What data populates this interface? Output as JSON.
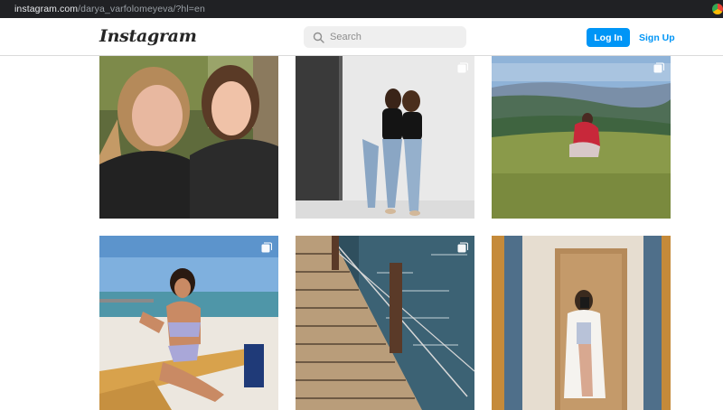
{
  "browser": {
    "url_host": "instagram.com",
    "url_path": "/darya_varfolomeyeva/?hl=en"
  },
  "header": {
    "logo": "Instagram",
    "search_placeholder": "Search",
    "login_label": "Log In",
    "signup_label": "Sign Up"
  },
  "colors": {
    "accent": "#0095f6",
    "search_bg": "#efefef",
    "border": "#dbdbdb"
  },
  "posts": [
    {
      "row": 1,
      "col": 1,
      "subject": "two-women-selfie-outdoors",
      "multi": false
    },
    {
      "row": 1,
      "col": 2,
      "subject": "two-women-hugging-studio",
      "multi": true
    },
    {
      "row": 1,
      "col": 3,
      "subject": "woman-sitting-mountain-meadow",
      "multi": true
    },
    {
      "row": 2,
      "col": 1,
      "subject": "woman-on-sunbed-beach",
      "multi": true
    },
    {
      "row": 2,
      "col": 2,
      "subject": "wooden-pier-water",
      "multi": true
    },
    {
      "row": 2,
      "col": 3,
      "subject": "mirror-selfie-doorway",
      "multi": false
    }
  ]
}
